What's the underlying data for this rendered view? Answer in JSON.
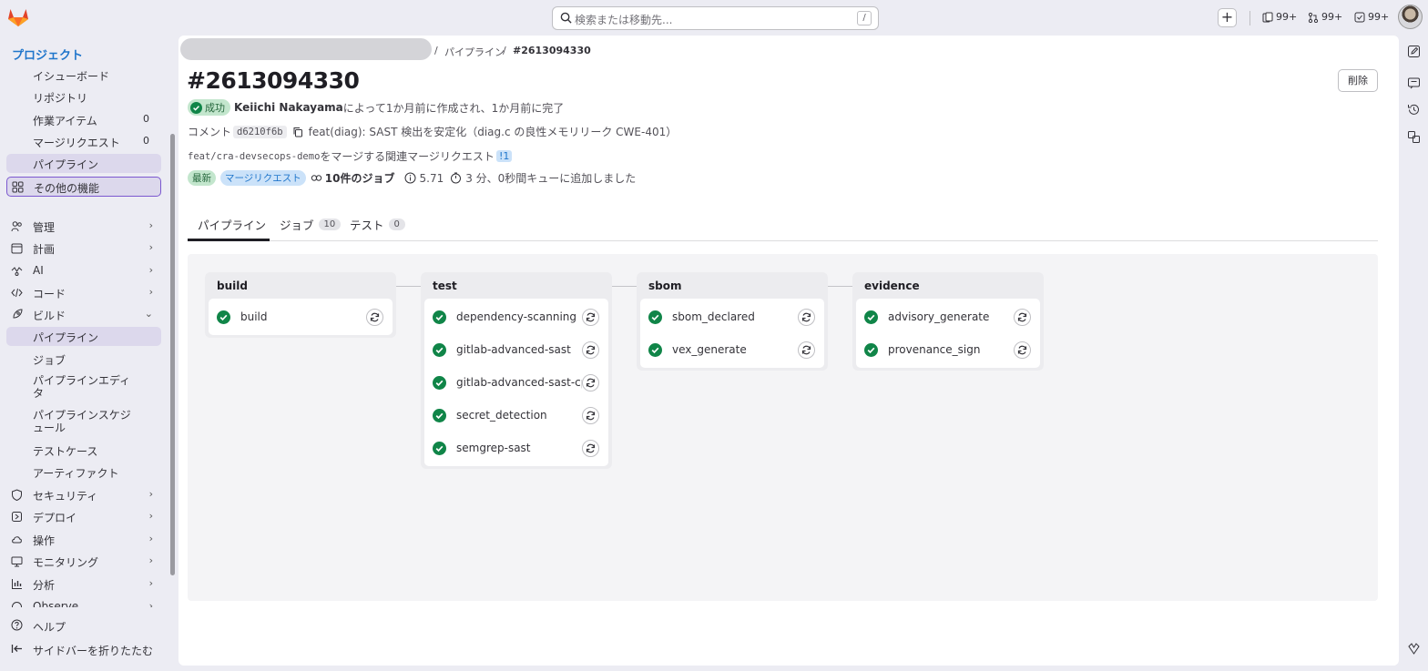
{
  "topbar": {
    "search_placeholder": "検索または移動先...",
    "search_shortcut": "/",
    "plus_label": "+",
    "issues_count": "99+",
    "mr_count": "99+",
    "todo_count": "99+"
  },
  "sidebar": {
    "section_title": "プロジェクト",
    "items": [
      {
        "label": "イシューボード"
      },
      {
        "label": "リポジトリ"
      },
      {
        "label": "作業アイテム",
        "count": "0"
      },
      {
        "label": "マージリクエスト",
        "count": "0"
      },
      {
        "label": "パイプライン"
      },
      {
        "label": "その他の機能"
      },
      {
        "label": "管理"
      },
      {
        "label": "計画"
      },
      {
        "label": "AI"
      },
      {
        "label": "コード"
      },
      {
        "label": "ビルド"
      },
      {
        "label": "パイプライン"
      },
      {
        "label": "ジョブ"
      },
      {
        "label": "パイプラインエディタ"
      },
      {
        "label": "パイプラインスケジュール"
      },
      {
        "label": "テストケース"
      },
      {
        "label": "アーティファクト"
      },
      {
        "label": "セキュリティ"
      },
      {
        "label": "デプロイ"
      },
      {
        "label": "操作"
      },
      {
        "label": "モニタリング"
      },
      {
        "label": "分析"
      },
      {
        "label": "Observe"
      }
    ],
    "help_label": "ヘルプ",
    "collapse_label": "サイドバーを折りたたむ"
  },
  "breadcrumb": {
    "sep": "/",
    "pipelines": "パイプライン",
    "current": "#2613094330"
  },
  "pipeline": {
    "title": "#2613094330",
    "delete_label": "削除",
    "status": "成功",
    "author": "Keiichi Nakayama",
    "created_text": "によって1か月前に作成され、1か月前に完了",
    "comment_label": "コメント",
    "sha": "d6210f6b",
    "commit_message": "feat(diag): SAST 検出を安定化（diag.c の良性メモリリーク CWE-401）",
    "branch": "feat/cra-devsecops-demo",
    "branch_suffix": "をマージする関連マージリクエスト",
    "mr_ref": "!1",
    "badge_latest": "最新",
    "badge_mr": "マージリクエスト",
    "jobs_summary": "10件のジョブ",
    "duration": "5.71",
    "queued": "3 分、0秒間キューに追加しました"
  },
  "tabs": [
    {
      "label": "パイプライン"
    },
    {
      "label": "ジョブ",
      "count": "10"
    },
    {
      "label": "テスト",
      "count": "0"
    }
  ],
  "stages": [
    {
      "name": "build",
      "jobs": [
        "build"
      ]
    },
    {
      "name": "test",
      "jobs": [
        "dependency-scanning",
        "gitlab-advanced-sast",
        "gitlab-advanced-sast-cpp",
        "secret_detection",
        "semgrep-sast"
      ]
    },
    {
      "name": "sbom",
      "jobs": [
        "sbom_declared",
        "vex_generate"
      ]
    },
    {
      "name": "evidence",
      "jobs": [
        "advisory_generate",
        "provenance_sign"
      ]
    }
  ],
  "colors": {
    "success": "#108548",
    "accent": "#7b58cf",
    "link": "#1f75cb"
  }
}
